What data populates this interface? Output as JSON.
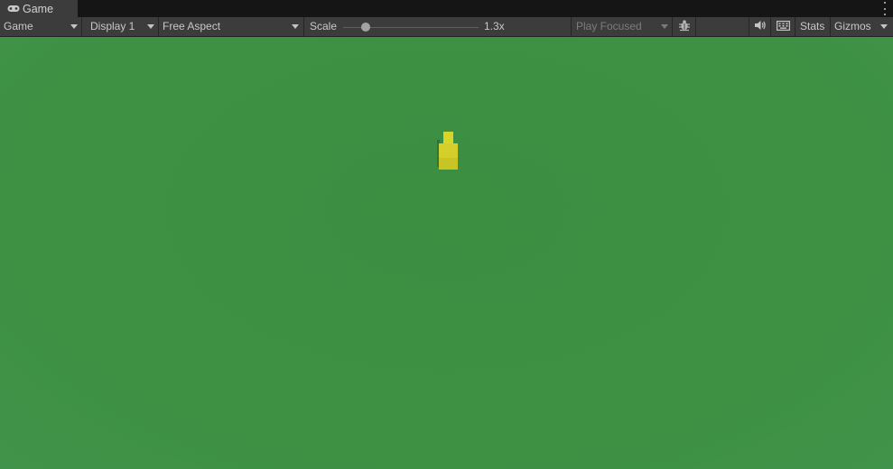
{
  "window": {
    "tab_title": "Game",
    "tab_icon": "gamepad-icon",
    "menu_icon": "kebab-menu-icon"
  },
  "toolbar": {
    "view_mode": "Game",
    "display": "Display 1",
    "aspect": "Free Aspect",
    "scale_label": "Scale",
    "scale_value": "1.3x",
    "play_mode": "Play Focused",
    "debug_icon": "bug-icon",
    "audio_icon": "speaker-icon",
    "keyboard_icon": "keyboard-icon",
    "stats_label": "Stats",
    "gizmos_label": "Gizmos"
  },
  "game": {
    "background_color": "#3d8f42",
    "player_color": "#d1d12a"
  }
}
